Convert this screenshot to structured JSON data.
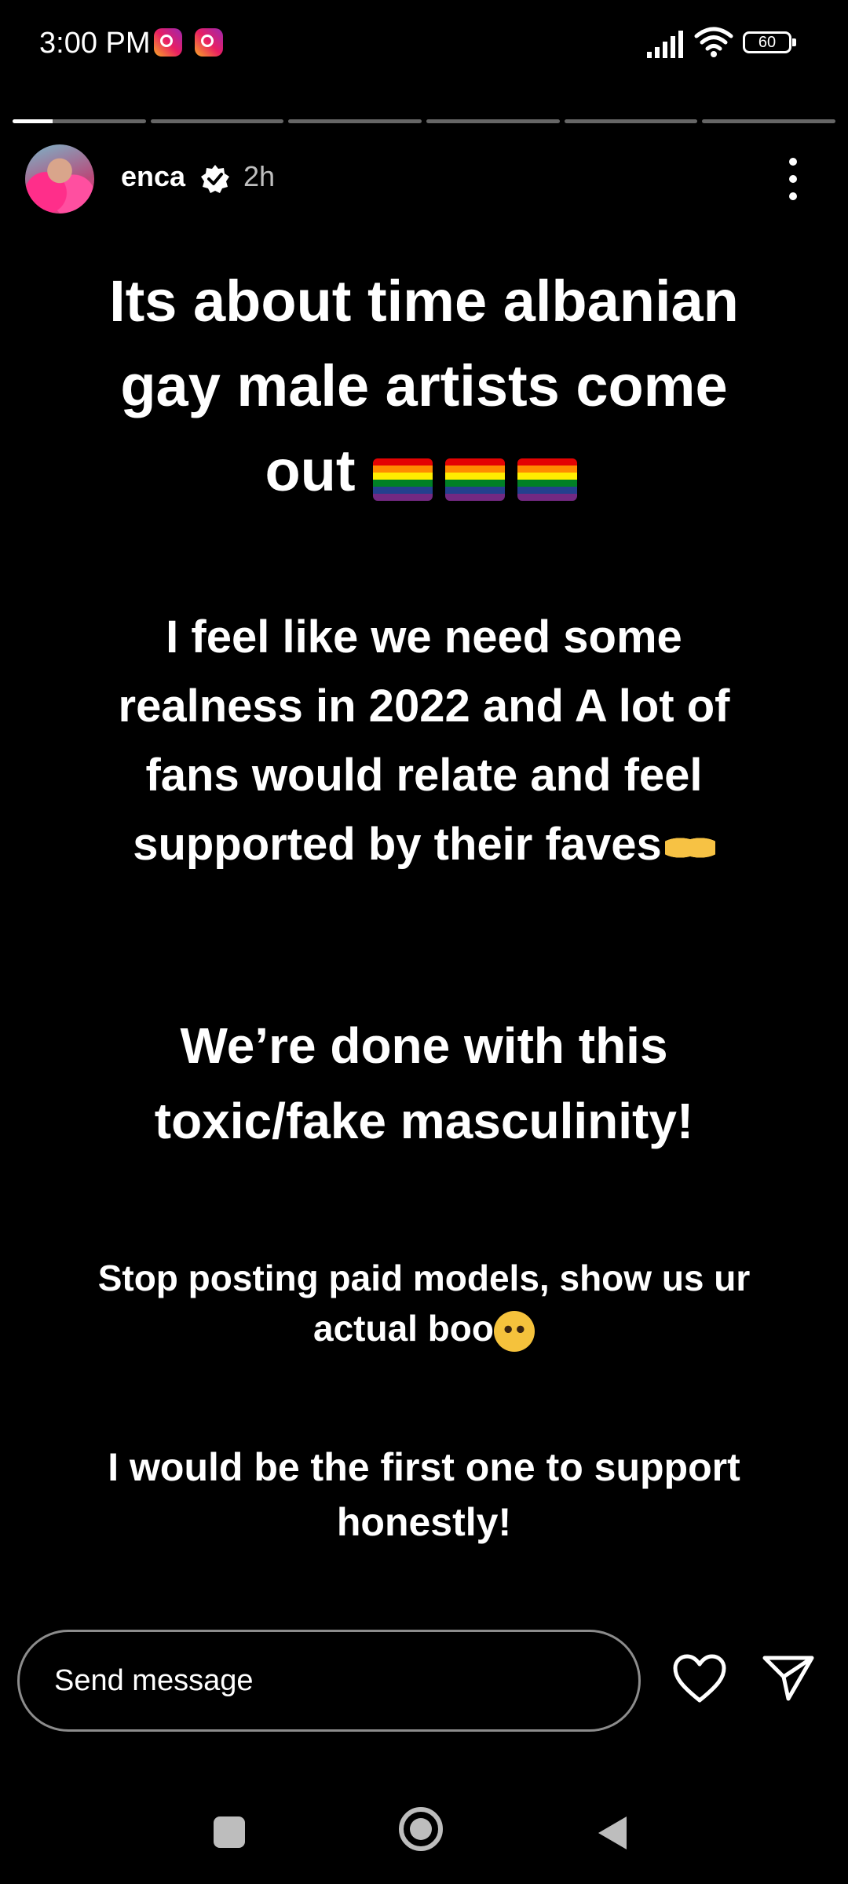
{
  "status_bar": {
    "time": "3:00 PM",
    "notification_icons": [
      "instagram-icon",
      "instagram-icon"
    ],
    "battery_level": "60",
    "icons": [
      "signal-icon",
      "wifi-icon",
      "battery-icon"
    ]
  },
  "story": {
    "segments_total": 6,
    "current_segment": 1,
    "current_progress": 0.3,
    "username": "enca",
    "verified": true,
    "time_ago": "2h",
    "text": {
      "block1_line1": "Its about time albanian",
      "block1_line2": "gay male artists come",
      "block1_line3": "out",
      "block2_line1": "I feel like we need some",
      "block2_line2": "realness in 2022 and A lot of",
      "block2_line3": "fans would relate and feel",
      "block2_line4": "supported by their faves",
      "block3_line1": "We’re done with this",
      "block3_line2": "toxic/fake masculinity!",
      "block4_line1": "Stop posting paid models, show us ur",
      "block4_line2": "actual boo",
      "block5_line1": "I would be the first one to support",
      "block5_line2": "honestly!"
    },
    "emojis": [
      "rainbow-flag",
      "rainbow-flag",
      "rainbow-flag",
      "heart-hands",
      "pleading-face"
    ]
  },
  "reply_bar": {
    "placeholder": "Send message",
    "icons": [
      "heart-icon",
      "send-icon"
    ]
  },
  "nav_bar": {
    "icons": [
      "recents-icon",
      "home-icon",
      "back-icon"
    ]
  },
  "colors": {
    "background": "#000000",
    "text": "#ffffff",
    "nav_icons": "#bdbdbd"
  }
}
